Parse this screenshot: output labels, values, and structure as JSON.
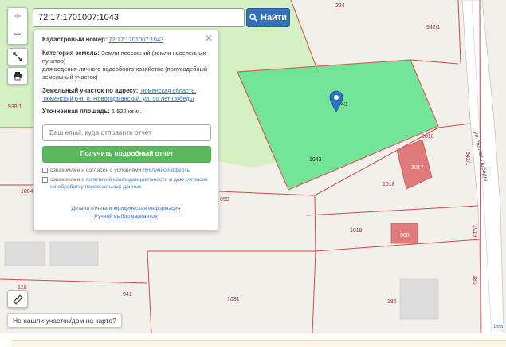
{
  "search": {
    "value": "72:17:1701007:1043",
    "button_label": "Найти"
  },
  "zoom": {
    "in_label": "+",
    "out_label": "−"
  },
  "panel": {
    "cadastral_label": "Кадастровый номер:",
    "cadastral_value": "72:17:1701007:1043",
    "category_label": "Категория земель:",
    "category_value": "Земли поселений (земли населенных пунктов)",
    "usage_value": "для ведения личного подсобного хозяйства (приусадебный земельный участок)",
    "address_label": "Земельный участок по адресу:",
    "address_value": "Тюменская область, Тюменский р-н, п. Новотарманский, ул. 50 лет Победы",
    "area_label": "Уточненная площадь:",
    "area_value": "1 522 кв.м.",
    "email_placeholder": "Ваш email, куда отправить отчет",
    "order_button": "Получить подробный отчет",
    "consent1_prefix": "ознакомлен и согласен с условиями",
    "consent1_link": "публичной оферты",
    "consent2_prefix": "ознакомлен с",
    "consent2_link1": "политикой конфиденциальности",
    "consent2_mid": "и даю",
    "consent2_link2": "согласие на обработку персональных данных",
    "link_details": "Детали отчета и юридическая информация",
    "link_manual": "Ручной выбор вариантов"
  },
  "map": {
    "labels": {
      "p224": "224",
      "p942_1a": "942/1",
      "p942_1b": "942/1",
      "p938_1": "938/1",
      "p1004": "1004",
      "p1043": "1043",
      "p1043b": "43",
      "p053": "053",
      "p1018a": "1018",
      "p1018b": "1018",
      "p1017": "1017",
      "p1019a": "1019",
      "p1019b": "1019",
      "p988": "988",
      "p941": "941",
      "p1031": "1031",
      "p186a": "186",
      "p186b": "186",
      "p128": "128",
      "road": "ул. 50 лет Победы"
    }
  },
  "not_found": "Не нашли участок/дом на карте?",
  "attribution": "Lea"
}
